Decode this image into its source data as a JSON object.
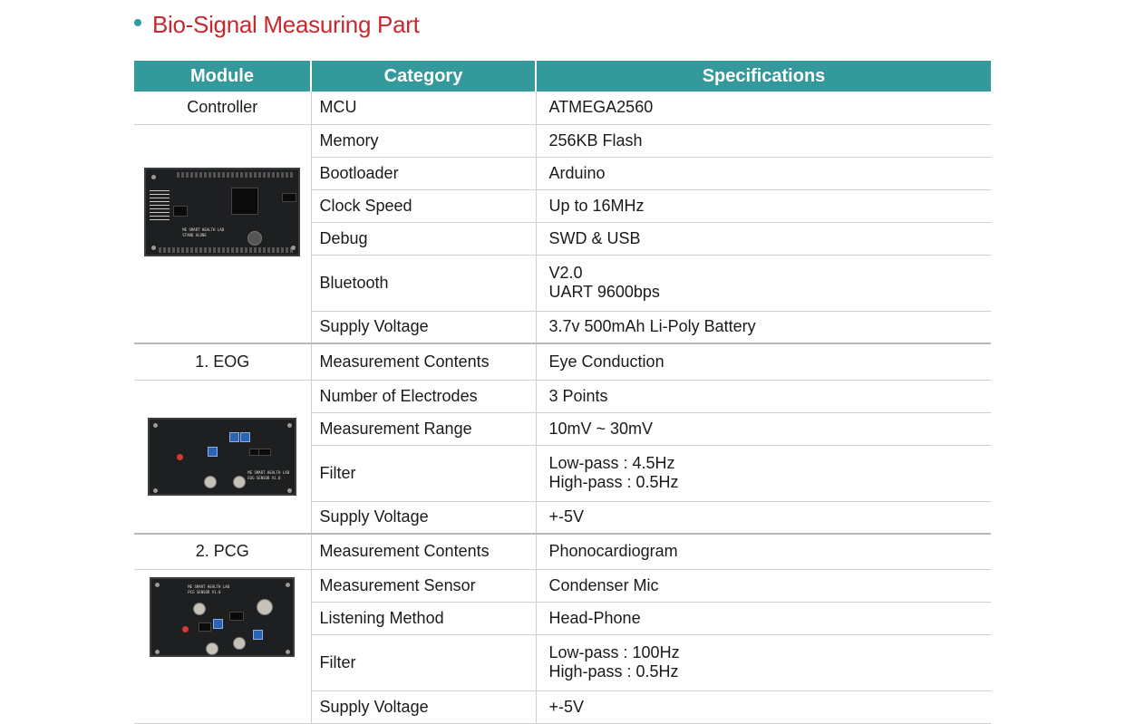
{
  "title": "Bio-Signal Measuring Part",
  "headers": {
    "module": "Module",
    "category": "Category",
    "specifications": "Specifications"
  },
  "modules": {
    "controller": {
      "name": "Controller",
      "rows": [
        {
          "category": "MCU",
          "spec": "ATMEGA2560"
        },
        {
          "category": "Memory",
          "spec": "256KB Flash"
        },
        {
          "category": "Bootloader",
          "spec": "Arduino"
        },
        {
          "category": "Clock Speed",
          "spec": "Up to 16MHz"
        },
        {
          "category": "Debug",
          "spec": "SWD & USB"
        },
        {
          "category": "Bluetooth",
          "spec": "V2.0",
          "spec2": "UART 9600bps"
        },
        {
          "category": "Supply Voltage",
          "spec": "3.7v 500mAh Li-Poly Battery"
        }
      ],
      "board_silk": [
        "ME SMART HEALTH LAB",
        "STAND ALONE"
      ]
    },
    "eog": {
      "name": "1. EOG",
      "rows": [
        {
          "category": "Measurement Contents",
          "spec": "Eye Conduction"
        },
        {
          "category": "Number of Electrodes",
          "spec": "3 Points"
        },
        {
          "category": "Measurement Range",
          "spec": "10mV ~ 30mV"
        },
        {
          "category": "Filter",
          "spec": "Low-pass : 4.5Hz",
          "spec2": "High-pass : 0.5Hz"
        },
        {
          "category": "Supply Voltage",
          "spec": "+-5V"
        }
      ],
      "board_silk": [
        "ME SMART HEALTH LAB",
        "EOG SENSOR V1.0"
      ]
    },
    "pcg": {
      "name": "2. PCG",
      "rows": [
        {
          "category": "Measurement Contents",
          "spec": "Phonocardiogram"
        },
        {
          "category": "Measurement Sensor",
          "spec": "Condenser Mic"
        },
        {
          "category": "Listening Method",
          "spec": "Head-Phone"
        },
        {
          "category": "Filter",
          "spec": "Low-pass : 100Hz",
          "spec2": "High-pass : 0.5Hz"
        },
        {
          "category": "Supply Voltage",
          "spec": "+-5V"
        }
      ],
      "board_silk": [
        "ME SMART HEALTH LAB",
        "PCG SENSOR V1.0"
      ]
    }
  },
  "colors": {
    "accent": "#34999b",
    "title_red": "#c8282f",
    "bullet": "#2f9ea1"
  }
}
